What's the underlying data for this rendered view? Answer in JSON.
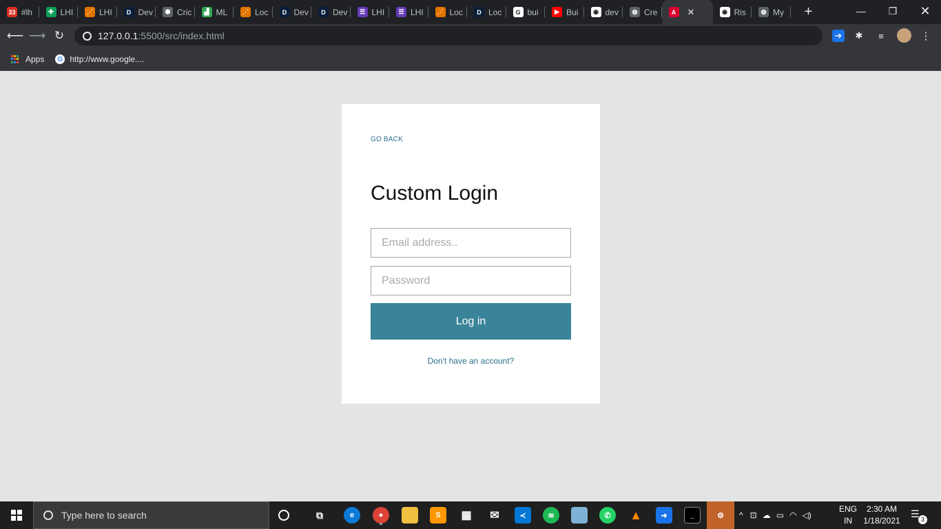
{
  "browser": {
    "tabs": [
      {
        "label": "#lh",
        "color": "#d93025",
        "glyph": "33"
      },
      {
        "label": "LHI",
        "color": "#0f9d58",
        "glyph": "✚"
      },
      {
        "label": "LHI",
        "color": "#e37400",
        "glyph": "⋰"
      },
      {
        "label": "Dev",
        "color": "#0a1e3a",
        "glyph": "D"
      },
      {
        "label": "Cric",
        "color": "#5f6368",
        "glyph": "⬢"
      },
      {
        "label": "ML",
        "color": "#34a853",
        "glyph": "▟"
      },
      {
        "label": "Loc",
        "color": "#e37400",
        "glyph": "⋰"
      },
      {
        "label": "Dev",
        "color": "#0a1e3a",
        "glyph": "D"
      },
      {
        "label": "Dev",
        "color": "#0a1e3a",
        "glyph": "D"
      },
      {
        "label": "LHI",
        "color": "#673ab7",
        "glyph": "☰"
      },
      {
        "label": "LHI",
        "color": "#673ab7",
        "glyph": "☰"
      },
      {
        "label": "Loc",
        "color": "#e37400",
        "glyph": "⋰"
      },
      {
        "label": "Loc",
        "color": "#0a1e3a",
        "glyph": "D"
      },
      {
        "label": "bui",
        "color": "#ffffff",
        "glyph": "G"
      },
      {
        "label": "Bui",
        "color": "#ff0000",
        "glyph": "▶"
      },
      {
        "label": "dev",
        "color": "#ffffff",
        "glyph": "◉"
      },
      {
        "label": "Cre",
        "color": "#5f6368",
        "glyph": "◍"
      },
      {
        "label": "",
        "color": "#dd0031",
        "glyph": "A",
        "active": true
      },
      {
        "label": "Ris",
        "color": "#ffffff",
        "glyph": "◉"
      },
      {
        "label": "My",
        "color": "#5f6368",
        "glyph": "◍"
      }
    ],
    "new_tab": "+",
    "url_host": "127.0.0.1",
    "url_path": ":5500/src/index.html",
    "bookmarks": {
      "apps": "Apps",
      "google": "http://www.google...."
    }
  },
  "login": {
    "go_back": "GO BACK",
    "title": "Custom Login",
    "email_placeholder": "Email address..",
    "password_placeholder": "Password",
    "login_button": "Log in",
    "signup_link": "Don't have an account?"
  },
  "taskbar": {
    "search_placeholder": "Type here to search",
    "lang_top": "ENG",
    "lang_bottom": "IN",
    "time": "2:30 AM",
    "date": "1/18/2021",
    "notification_count": "3"
  }
}
